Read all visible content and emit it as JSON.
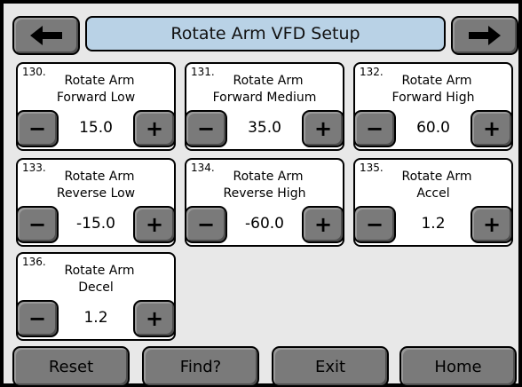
{
  "header": {
    "title": "Rotate Arm VFD Setup",
    "back_icon": "left-arrow-icon",
    "forward_icon": "right-arrow-icon"
  },
  "params": [
    {
      "number": "130.",
      "line1": "Rotate Arm",
      "line2": "Forward Low",
      "value": "15.0"
    },
    {
      "number": "131.",
      "line1": "Rotate Arm",
      "line2": "Forward Medium",
      "value": "35.0"
    },
    {
      "number": "132.",
      "line1": "Rotate Arm",
      "line2": "Forward High",
      "value": "60.0"
    },
    {
      "number": "133.",
      "line1": "Rotate Arm",
      "line2": "Reverse Low",
      "value": "-15.0"
    },
    {
      "number": "134.",
      "line1": "Rotate Arm",
      "line2": "Reverse High",
      "value": "-60.0"
    },
    {
      "number": "135.",
      "line1": "Rotate Arm",
      "line2": "Accel",
      "value": "1.2"
    },
    {
      "number": "136.",
      "line1": "Rotate Arm",
      "line2": "Decel",
      "value": "1.2"
    }
  ],
  "stepper": {
    "minus": "−",
    "plus": "+"
  },
  "footer": {
    "reset": "Reset",
    "find": "Find?",
    "exit": "Exit",
    "home": "Home"
  },
  "colors": {
    "title_bar": "#b9d2e6",
    "button": "#7a7a7a",
    "card": "#ffffff",
    "background": "#e8e8e8"
  }
}
